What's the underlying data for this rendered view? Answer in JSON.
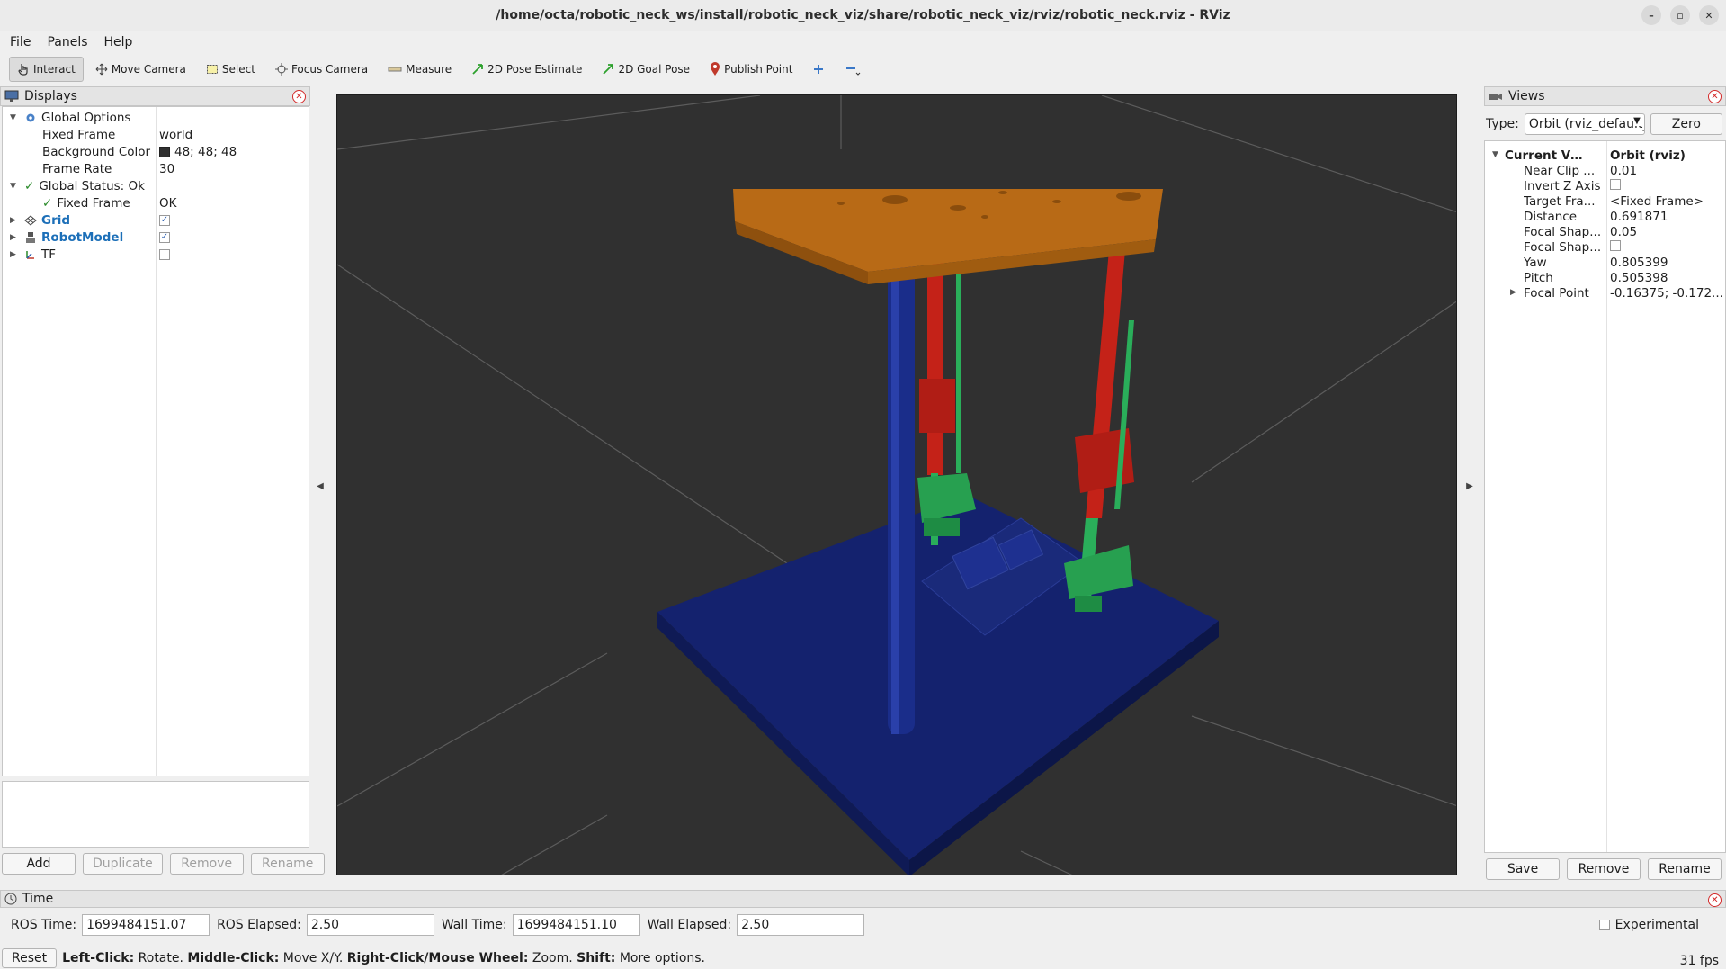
{
  "window": {
    "title": "/home/octa/robotic_neck_ws/install/robotic_neck_viz/share/robotic_neck_viz/rviz/robotic_neck.rviz - RViz",
    "controls": [
      "–",
      "▫",
      "✕"
    ]
  },
  "menu": {
    "file": "File",
    "panels": "Panels",
    "help": "Help"
  },
  "toolbar": {
    "interact": "Interact",
    "move_camera": "Move Camera",
    "select": "Select",
    "focus_camera": "Focus Camera",
    "measure": "Measure",
    "pose_estimate": "2D Pose Estimate",
    "goal_pose": "2D Goal Pose",
    "publish_point": "Publish Point",
    "plus_icon": "plus-icon",
    "minus_icon": "minus-icon"
  },
  "displays": {
    "title": "Displays",
    "global_options": "Global Options",
    "fixed_frame_label": "Fixed Frame",
    "fixed_frame_value": "world",
    "bg_color_label": "Background Color",
    "bg_color_value": "48; 48; 48",
    "bg_color_hex": "#303030",
    "frame_rate_label": "Frame Rate",
    "frame_rate_value": "30",
    "global_status": "Global Status: Ok",
    "status_fixed_frame_label": "Fixed Frame",
    "status_fixed_frame_value": "OK",
    "grid": "Grid",
    "robot_model": "RobotModel",
    "tf": "TF",
    "grid_enabled": true,
    "robot_model_enabled": true,
    "tf_enabled": false,
    "buttons": {
      "add": "Add",
      "duplicate": "Duplicate",
      "remove": "Remove",
      "rename": "Rename"
    }
  },
  "views": {
    "title": "Views",
    "type_label": "Type:",
    "type_value": "Orbit (rviz_default_plugins)",
    "zero": "Zero",
    "current_view_label": "Current View",
    "current_view_value": "Orbit (rviz)",
    "props": [
      {
        "label": "Near Clip ...",
        "value": "0.01"
      },
      {
        "label": "Invert Z Axis",
        "value": ""
      },
      {
        "label": "Target Fra...",
        "value": "<Fixed Frame>"
      },
      {
        "label": "Distance",
        "value": "0.691871"
      },
      {
        "label": "Focal Shap...",
        "value": "0.05"
      },
      {
        "label": "Focal Shap...",
        "value": ""
      },
      {
        "label": "Yaw",
        "value": "0.805399"
      },
      {
        "label": "Pitch",
        "value": "0.505398"
      },
      {
        "label": "Focal Point",
        "value": "-0.16375; -0.172..."
      }
    ],
    "buttons": {
      "save": "Save",
      "remove": "Remove",
      "rename": "Rename"
    }
  },
  "time": {
    "title": "Time",
    "ros_time_label": "ROS Time:",
    "ros_time_value": "1699484151.07",
    "ros_elapsed_label": "ROS Elapsed:",
    "ros_elapsed_value": "2.50",
    "wall_time_label": "Wall Time:",
    "wall_time_value": "1699484151.10",
    "wall_elapsed_label": "Wall Elapsed:",
    "wall_elapsed_value": "2.50",
    "experimental": "Experimental"
  },
  "status": {
    "reset": "Reset",
    "left_click": "Left-Click:",
    "left_click_desc": " Rotate. ",
    "middle_click": "Middle-Click:",
    "middle_click_desc": " Move X/Y. ",
    "right_click": "Right-Click/Mouse Wheel:",
    "right_click_desc": " Zoom. ",
    "shift": "Shift:",
    "shift_desc": " More options.",
    "fps": "31 fps"
  },
  "colors": {
    "top_plate": "#b86a16",
    "base_plate": "#14226e",
    "pillar": "#1a2d8a",
    "actuator_red": "#c42218",
    "actuator_green": "#2aae5a",
    "grid_line": "#5a5a5a"
  }
}
